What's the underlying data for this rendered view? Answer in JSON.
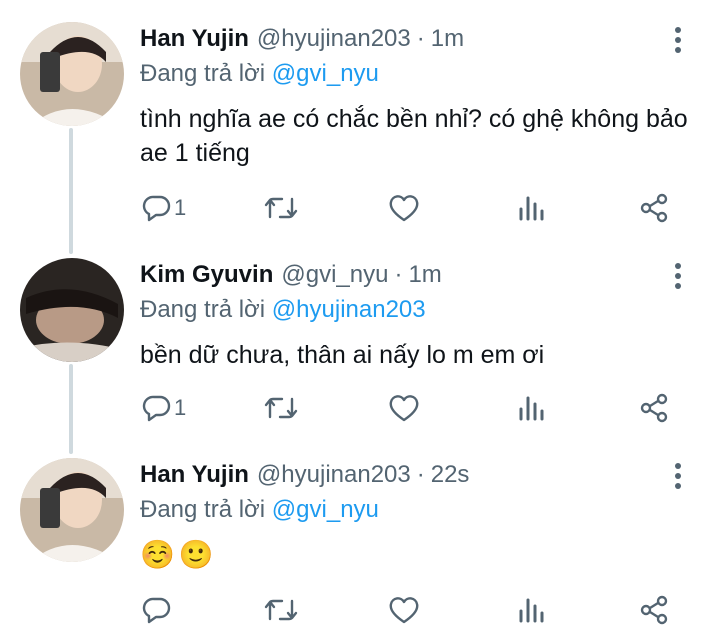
{
  "tweets": [
    {
      "name": "Han Yujin",
      "handle": "@hyujinan203",
      "separator": "·",
      "time": "1m",
      "reply_prefix": "Đang trả lời",
      "reply_to": "@gvi_nyu",
      "text": "tình nghĩa ae có chắc bền nhỉ? có ghệ không bảo ae 1 tiếng",
      "reply_count": "1"
    },
    {
      "name": "Kim Gyuvin",
      "handle": "@gvi_nyu",
      "separator": "·",
      "time": "1m",
      "reply_prefix": "Đang trả lời",
      "reply_to": "@hyujinan203",
      "text": "bền dữ chưa, thân ai nấy lo m em ơi",
      "reply_count": "1"
    },
    {
      "name": "Han Yujin",
      "handle": "@hyujinan203",
      "separator": "·",
      "time": "22s",
      "reply_prefix": "Đang trả lời",
      "reply_to": "@gvi_nyu",
      "emojis": [
        "☺️",
        "🙂"
      ],
      "reply_count": ""
    }
  ],
  "icons": {
    "reply": "comment-icon",
    "retweet": "retweet-icon",
    "like": "heart-icon",
    "analytics": "analytics-icon",
    "share": "share-icon",
    "more": "more-vertical-icon"
  },
  "colors": {
    "text": "#0f1419",
    "secondary": "#536471",
    "link": "#1d9bf0",
    "thread_line": "#cfd9de"
  }
}
